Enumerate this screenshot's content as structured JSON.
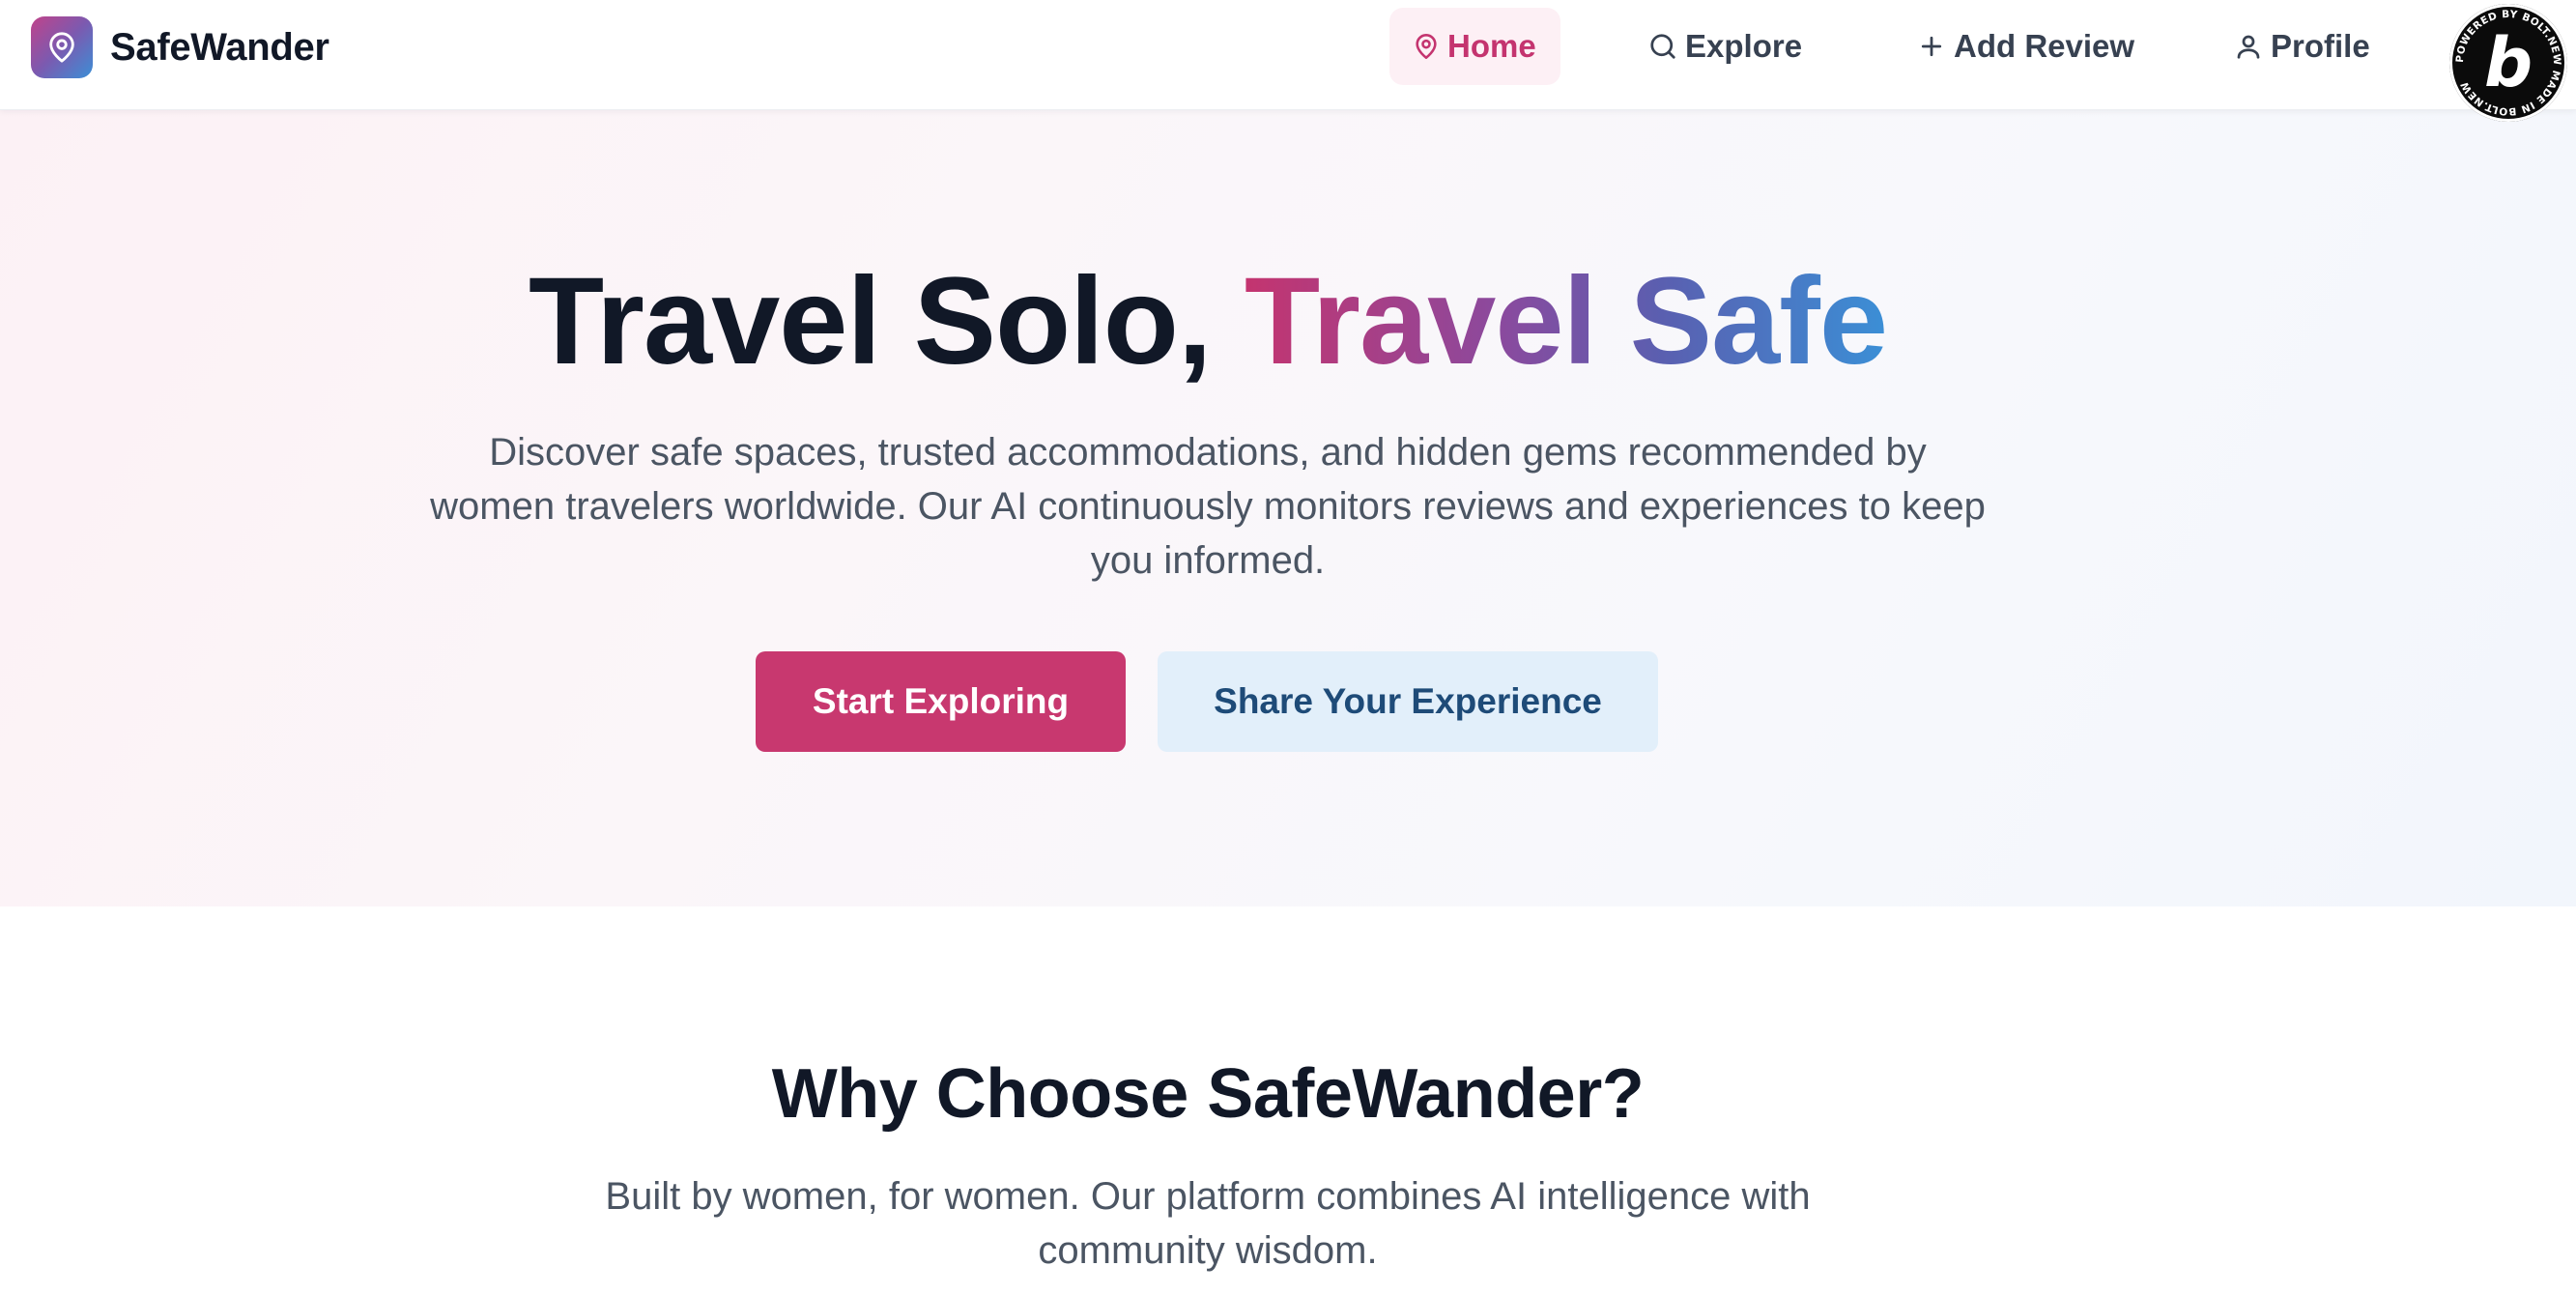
{
  "brand": {
    "name": "SafeWander",
    "logo_icon": "map-pin-icon"
  },
  "nav": {
    "items": [
      {
        "label": "Home",
        "icon": "map-pin-icon",
        "active": true
      },
      {
        "label": "Explore",
        "icon": "search-icon",
        "active": false
      },
      {
        "label": "Add Review",
        "icon": "plus-icon",
        "active": false
      },
      {
        "label": "Profile",
        "icon": "user-icon",
        "active": false
      }
    ]
  },
  "badge": {
    "ring_text": "POWERED BY BOLT.NEW MADE IN BOLT.NEW",
    "letter": "b"
  },
  "hero": {
    "title_plain": "Travel Solo,",
    "title_accent": "Travel Safe",
    "subtitle": "Discover safe spaces, trusted accommodations, and hidden gems recommended by women travelers worldwide. Our AI continuously monitors reviews and experiences to keep you informed.",
    "primary_button": "Start Exploring",
    "secondary_button": "Share Your Experience"
  },
  "why": {
    "title": "Why Choose SafeWander?",
    "subtitle": "Built by women, for women. Our platform combines AI intelligence with community wisdom."
  },
  "colors": {
    "accent_pink": "#c8386f",
    "accent_blue": "#3b8fd6",
    "heading": "#111827",
    "body": "#4b5563"
  }
}
